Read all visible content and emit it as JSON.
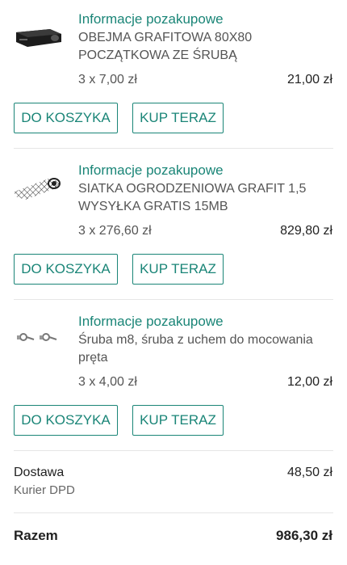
{
  "items": [
    {
      "info_link": "Informacje pozakupowe",
      "name": "OBEJMA GRAFITOWA 80X80 POCZĄTKOWA ZE ŚRUBĄ",
      "qty_price": "3 x 7,00 zł",
      "total": "21,00 zł",
      "thumb_icon": "projector-bracket-thumbnail"
    },
    {
      "info_link": "Informacje pozakupowe",
      "name": "SIATKA OGRODZENIOWA GRAFIT 1,5 WYSYŁKA GRATIS 15MB",
      "qty_price": "3 x 276,60 zł",
      "total": "829,80 zł",
      "thumb_icon": "mesh-roll-thumbnail"
    },
    {
      "info_link": "Informacje pozakupowe",
      "name": "Śruba m8, śruba z uchem do mocowania pręta",
      "qty_price": "3 x 4,00 zł",
      "total": "12,00 zł",
      "thumb_icon": "eye-bolt-thumbnail"
    }
  ],
  "buttons": {
    "cart": "DO KOSZYKA",
    "buy": "KUP TERAZ"
  },
  "summary": {
    "delivery_label": "Dostawa",
    "delivery_method": "Kurier DPD",
    "delivery_price": "48,50 zł",
    "total_label": "Razem",
    "total_price": "986,30 zł"
  },
  "colors": {
    "accent": "#1a8577",
    "divider": "#e6e6e6"
  }
}
